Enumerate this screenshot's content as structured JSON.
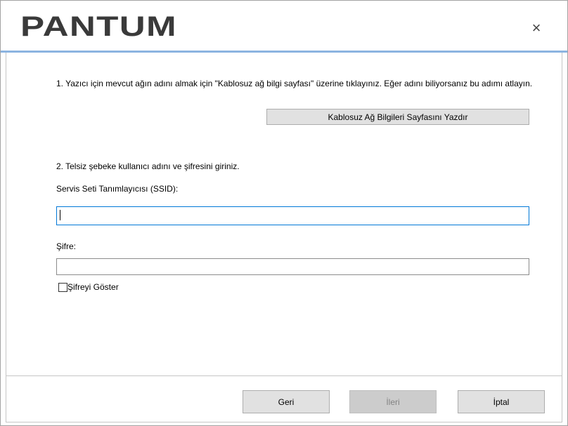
{
  "window": {
    "logo_text": "PANTUM",
    "close_label": "×"
  },
  "step1": {
    "instruction": "1. Yazıcı için mevcut ağın adını almak için \"Kablosuz ağ bilgi sayfası\" üzerine tıklayınız. Eğer adını biliyorsanız bu adımı atlayın.",
    "print_button_label": "Kablosuz Ağ Bilgileri Sayfasını Yazdır"
  },
  "step2": {
    "instruction": "2. Telsiz şebeke kullanıcı adını ve şifresini giriniz.",
    "ssid_label": "Servis Seti Tanımlayıcısı (SSID):",
    "ssid_value": "",
    "ssid_focused": true,
    "password_label": "Şifre:",
    "password_value": "",
    "show_password_label": "Şifreyi Göster",
    "show_password_checked": false
  },
  "footer": {
    "back_label": "Geri",
    "next_label": "İleri",
    "next_enabled": false,
    "cancel_label": "İptal"
  },
  "colors": {
    "accent": "#0078d7",
    "header_rule": "#8cb4e0",
    "logo": "#3a3a3a"
  }
}
